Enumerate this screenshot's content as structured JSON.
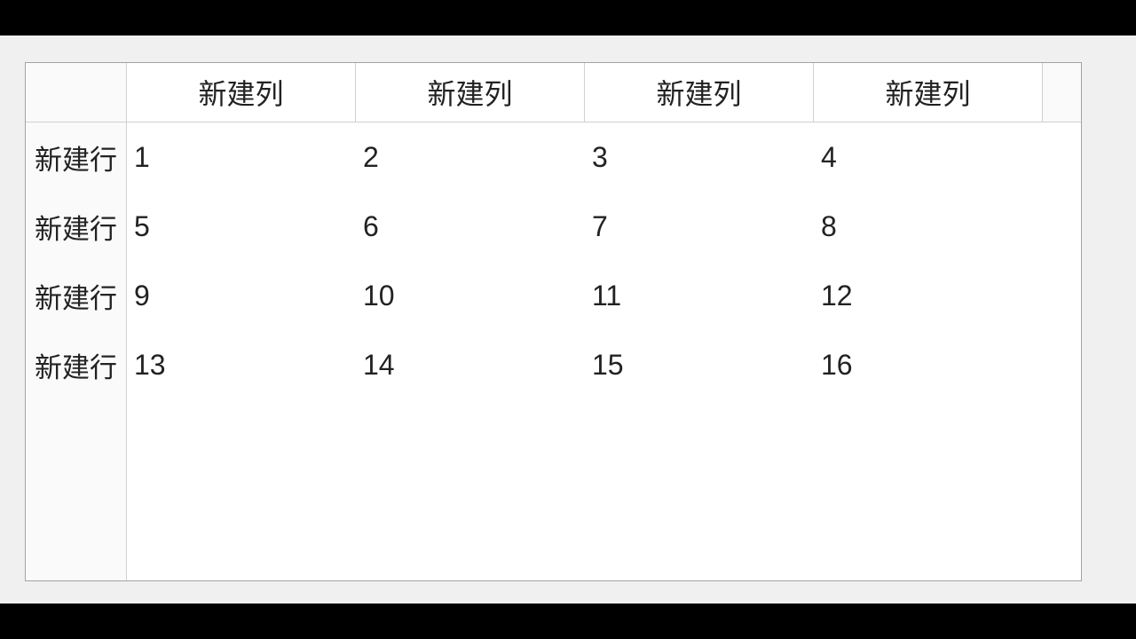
{
  "table": {
    "column_headers": [
      "新建列",
      "新建列",
      "新建列",
      "新建列"
    ],
    "row_headers": [
      "新建行",
      "新建行",
      "新建行",
      "新建行"
    ],
    "rows": [
      [
        "1",
        "2",
        "3",
        "4"
      ],
      [
        "5",
        "6",
        "7",
        "8"
      ],
      [
        "9",
        "10",
        "11",
        "12"
      ],
      [
        "13",
        "14",
        "15",
        "16"
      ]
    ]
  }
}
